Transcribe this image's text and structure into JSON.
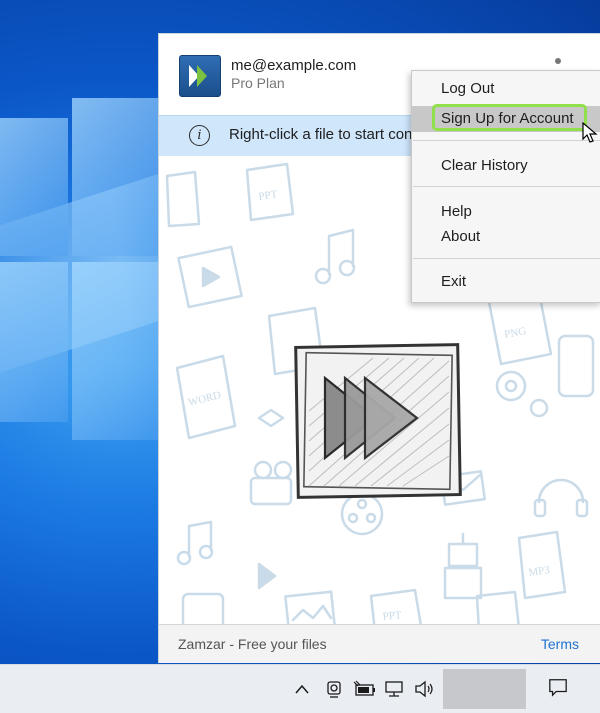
{
  "app": {
    "account_email": "me@example.com",
    "plan": "Pro Plan",
    "banner_text": "Right-click a file to start con",
    "footer_text": "Zamzar - Free your files",
    "terms_label": "Terms"
  },
  "menu": {
    "items": [
      "Log Out",
      "Sign Up for Account",
      "Clear History",
      "Help",
      "About",
      "Exit"
    ],
    "highlighted": "Sign Up for Account"
  },
  "art_labels": {
    "ppt": "PPT",
    "png": "PNG",
    "word": "WORD",
    "mp3": "MP3"
  },
  "colors": {
    "banner_bg": "#cfe6fb",
    "menu_highlight": "#c8c8c8",
    "highlight_outline": "#8fe04a",
    "link": "#1f73d1",
    "logo_blue": "#2f6db3",
    "logo_green": "#7cc242"
  },
  "taskbar": {
    "tray_icons": [
      "chevron-up-icon",
      "camera-icon",
      "battery-icon",
      "network-icon",
      "volume-icon",
      "notification-icon"
    ]
  }
}
